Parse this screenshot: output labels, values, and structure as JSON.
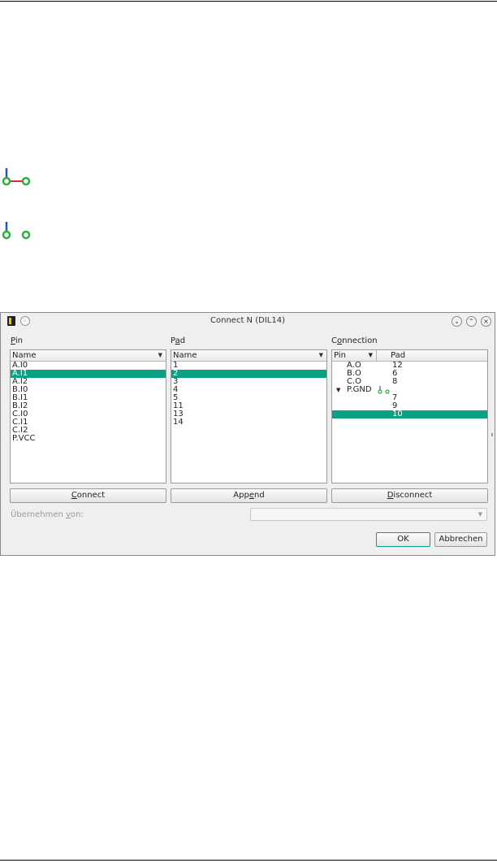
{
  "dialog": {
    "title": "Connect N (DIL14)",
    "pin_label_u": "P",
    "pin_label_rest": "in",
    "pad_label_pre": "P",
    "pad_label_u": "a",
    "pad_label_rest": "d",
    "connection_label_pre": "C",
    "connection_label_u": "o",
    "connection_label_rest": "nnection",
    "pin_list": {
      "header": "Name",
      "items": [
        "A.I0",
        "A.I1",
        "A.I2",
        "B.I0",
        "B.I1",
        "B.I2",
        "C.I0",
        "C.I1",
        "C.I2",
        "P.VCC"
      ],
      "selected": "A.I1"
    },
    "pad_list": {
      "header": "Name",
      "items": [
        "1",
        "2",
        "3",
        "4",
        "5",
        "11",
        "13",
        "14"
      ],
      "selected": "2"
    },
    "connection_tree": {
      "header_pin": "Pin",
      "header_pad": "Pad",
      "rows": [
        {
          "pin": "A.O",
          "pad": "12"
        },
        {
          "pin": "B.O",
          "pad": "6"
        },
        {
          "pin": "C.O",
          "pad": "8"
        },
        {
          "pin": "P.GND",
          "pad": ""
        },
        {
          "pin": "",
          "pad": "7"
        },
        {
          "pin": "",
          "pad": "9"
        },
        {
          "pin": "",
          "pad": "10"
        }
      ]
    },
    "buttons": {
      "connect_u": "C",
      "connect_rest": "onnect",
      "append_pre": "App",
      "append_u": "e",
      "append_rest": "nd",
      "disconnect_u": "D",
      "disconnect_rest": "isconnect",
      "ok": "OK",
      "cancel": "Abbrechen"
    },
    "take_from_pre": "Übernehmen ",
    "take_from_u": "v",
    "take_from_rest": "on:",
    "take_from_value": ""
  },
  "colors": {
    "selection": "#0aa182",
    "connector_green": "#2fae3b",
    "connector_blue": "#2c4fc9",
    "connector_red": "#d23030"
  },
  "icons": [
    "connected-pad-icon",
    "unconnected-pad-icon",
    "app-icon",
    "pin-icon",
    "minimize-icon",
    "maximize-icon",
    "close-icon",
    "chevron-down-icon"
  ]
}
